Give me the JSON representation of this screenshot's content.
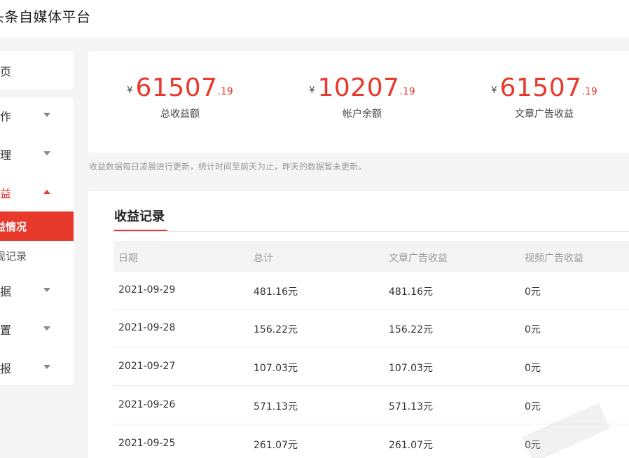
{
  "app": {
    "title": "头条自媒体平台"
  },
  "sidebar": {
    "home": "首页",
    "items": [
      {
        "label": "创作",
        "expanded": false
      },
      {
        "label": "管理",
        "expanded": false
      },
      {
        "label": "收益",
        "expanded": true,
        "children": [
          {
            "label": "收益情况",
            "active": true
          },
          {
            "label": "提现记录",
            "active": false
          }
        ]
      },
      {
        "label": "数据",
        "expanded": false
      },
      {
        "label": "设置",
        "expanded": false
      },
      {
        "label": "举报",
        "expanded": false
      }
    ]
  },
  "summary": [
    {
      "currency": "¥",
      "integer": "61507",
      "decimal": ".19",
      "label": "总收益额"
    },
    {
      "currency": "¥",
      "integer": "10207",
      "decimal": ".19",
      "label": "帐户余额"
    },
    {
      "currency": "¥",
      "integer": "61507",
      "decimal": ".19",
      "label": "文章广告收益"
    }
  ],
  "notice": "收益数据每日凌晨进行更新，统计时间至前天为止，昨天的数据暂未更新。",
  "records": {
    "title": "收益记录",
    "columns": [
      "日期",
      "总计",
      "文章广告收益",
      "视频广告收益"
    ],
    "rows": [
      [
        "2021-09-29",
        "481.16元",
        "481.16元",
        "0元"
      ],
      [
        "2021-09-28",
        "156.22元",
        "156.22元",
        "0元"
      ],
      [
        "2021-09-27",
        "107.03元",
        "107.03元",
        "0元"
      ],
      [
        "2021-09-26",
        "571.13元",
        "571.13元",
        "0元"
      ],
      [
        "2021-09-25",
        "261.07元",
        "261.07元",
        "0元"
      ]
    ]
  },
  "colors": {
    "accent": "#e8392d",
    "background": "#f5f5f5"
  }
}
